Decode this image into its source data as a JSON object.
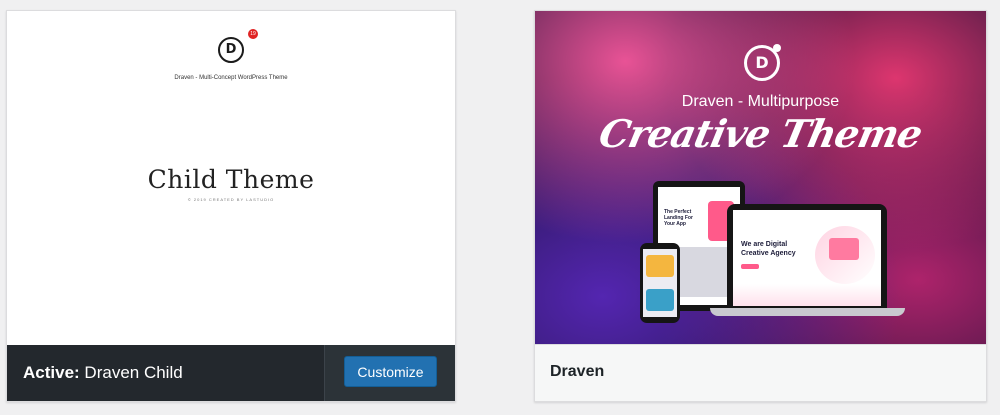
{
  "themes": {
    "active": {
      "status_label": "Active:",
      "name": "Draven Child",
      "customize_label": "Customize",
      "screenshot": {
        "logo_letter": "D",
        "badge": "19",
        "subtitle": "Draven - Multi-Concept WordPress Theme",
        "title": "Child Theme",
        "copyright": "© 2019 CREATED BY LASTUDIO"
      }
    },
    "draven": {
      "name": "Draven",
      "screenshot": {
        "logo_letter": "D",
        "heading": "Draven - Multipurpose",
        "script_title": "Creative Theme",
        "laptop_headline": "We are Digital Creative Agency",
        "tablet_headline": "The Perfect Landing For Your App"
      }
    }
  },
  "colors": {
    "background": "#f0f0f1",
    "active_bar": "#23282d",
    "button": "#2271b1"
  }
}
